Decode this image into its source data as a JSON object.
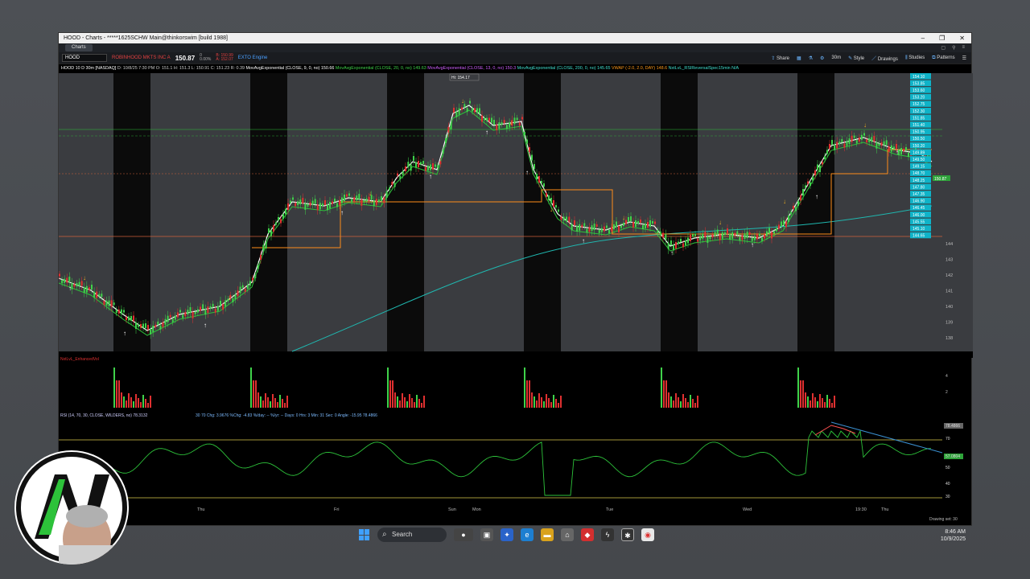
{
  "window": {
    "title": "HOOD - Charts - *****1625SCHW Main@thinkorswim [build 1988]",
    "tab": "Charts"
  },
  "toolbar": {
    "symbol": "HOOD",
    "company": "ROBINHOOD MKTS INC A",
    "price": "150.87",
    "change": "0",
    "change_pct": "0.00%",
    "bid": "B: 150.99",
    "ask": "A: 152.07",
    "ext_engine": "EXTO Engine",
    "share": "Share",
    "timeframe": "30m",
    "style": "Style",
    "drawings": "Drawings",
    "studies": "Studies",
    "patterns": "Patterns"
  },
  "studybar": {
    "head": "HOOD 10 D 30m [NASDAQ]",
    "ohlc": "D: 10/8/25 7:30 PM  O: 151.1  H: 151.3  L: 150.91  C: 151.23  R: 0.39",
    "ema9": "MovAvgExponential (CLOSE, 9, 0, no)  150.66",
    "ema20": "MovAvgExponential (CLOSE, 20, 0, no)  149.63",
    "ema13": "MovAvgExponential (CLOSE, 13, 0, no)  150.3",
    "ema200": "MovAvgExponential (CLOSE, 200, 0, no)  145.65",
    "vwap": "VWAP (-2.0, 2.0, DAY)  148.6",
    "rsiref": "NxtLvL_RSIReversalSpec15min   N/A"
  },
  "hilabel": "Hi: 154.17",
  "volume_label": "NxtLvL_EnhancedVol",
  "rsi_label": "RSI (14, 70, 30, CLOSE, WILDERS, no)  78.3132",
  "rsi_stats": "30  70   Chg: 3.9676  %Chg: -4.83   %/day: --   %/yr: --   Days: 0   Hrs: 3   Min: 31   Sec: 0   Angle: -15.95   78.4866",
  "date_axis": [
    "Thu",
    "Fri",
    "Sun",
    "Mon",
    "Tue",
    "Wed",
    "19:30",
    "Thu"
  ],
  "price_axis": [
    "144",
    "143",
    "142",
    "141",
    "140",
    "139",
    "138"
  ],
  "price_tags": [
    "154.10",
    "153.85",
    "153.60",
    "153.20",
    "152.75",
    "152.30",
    "151.85",
    "151.40",
    "150.95",
    "150.50",
    "150.20",
    "149.89",
    "149.50",
    "149.15",
    "148.70",
    "148.25",
    "147.80",
    "147.35",
    "146.90",
    "146.45",
    "146.00",
    "145.55",
    "145.10",
    "144.65"
  ],
  "rsi_axis": [
    "78.4866",
    "70",
    "57.0804",
    "50",
    "40",
    "30"
  ],
  "vol_axis": [
    "4",
    "2"
  ],
  "drawing_set": "Drawing set: 30",
  "taskbar": {
    "search": "Search",
    "time": "8:46 AM",
    "date": "10/9/2025"
  },
  "colors": {
    "ema9": "#ffffff",
    "ema20": "#2dc23a",
    "ema200": "#1fb8b0",
    "vwap": "#ff8c1a",
    "rsi": "#2dc23a",
    "accent": "#0fb3c8"
  }
}
